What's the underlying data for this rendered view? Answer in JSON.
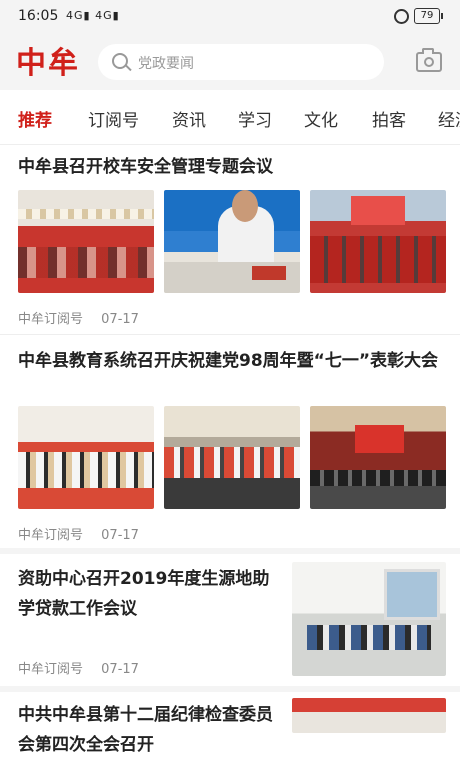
{
  "status_bar": {
    "time": "16:05",
    "signal": "4G▮ 4G▮",
    "battery": "79"
  },
  "header": {
    "logo": "中牟",
    "search_placeholder": "党政要闻"
  },
  "tabs": [
    "推荐",
    "订阅号",
    "资讯",
    "学习",
    "文化",
    "拍客",
    "经济"
  ],
  "articles": [
    {
      "title": "中牟县召开校车安全管理专题会议",
      "source": "中牟订阅号",
      "date": "07-17"
    },
    {
      "title": "中牟县教育系统召开庆祝建党98周年暨“七一”表彰大会",
      "source": "中牟订阅号",
      "date": "07-17"
    },
    {
      "title": "资助中心召开2019年度生源地助学贷款工作会议",
      "source": "中牟订阅号",
      "date": "07-17"
    },
    {
      "title": "中共中牟县第十二届纪律检查委员会第四次全会召开"
    }
  ],
  "colors": {
    "brand": "#d0201a",
    "active_tab": "#d0201a"
  }
}
